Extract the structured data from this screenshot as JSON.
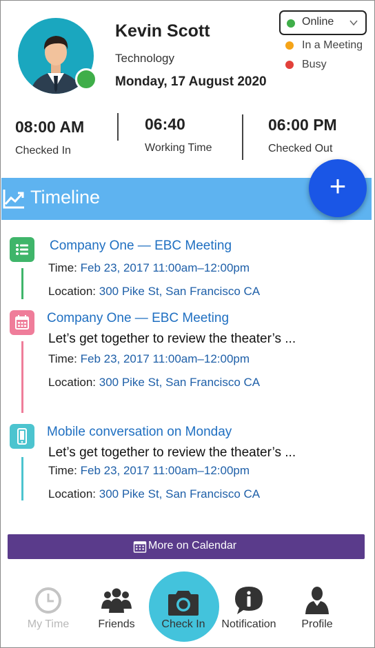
{
  "profile": {
    "name": "Kevin Scott",
    "department": "Technology",
    "date": "Monday, 17 August 2020"
  },
  "status": {
    "selected": {
      "label": "Online",
      "color": "#3fae49"
    },
    "options": [
      {
        "label": "In a Meeting",
        "color": "#f5a418"
      },
      {
        "label": "Busy",
        "color": "#e2403a"
      }
    ]
  },
  "times": {
    "checked_in": {
      "value": "08:00 AM",
      "label": "Checked In"
    },
    "working": {
      "value": "06:40",
      "label": "Working Time"
    },
    "checked_out": {
      "value": "06:00 PM",
      "label": "Checked Out"
    }
  },
  "timeline": {
    "title": "Timeline",
    "add_label": "+",
    "entries": [
      {
        "icon": "list-icon",
        "color": "#3fb56a",
        "title": "Company One — EBC Meeting",
        "description": "",
        "time_label": "Time:",
        "time": "Feb 23, 2017 11:00am–12:00pm",
        "location_label": "Location:",
        "location": "300 Pike St, San Francisco CA"
      },
      {
        "icon": "calendar-icon",
        "color": "#ef7d9a",
        "title": "Company One — EBC Meeting",
        "description": "Let’s get together to review the theater’s ...",
        "time_label": "Time:",
        "time": "Feb 23, 2017 11:00am–12:00pm",
        "location_label": "Location:",
        "location": "300 Pike St, San Francisco CA"
      },
      {
        "icon": "mobile-icon",
        "color": "#4cc4cf",
        "title": "Mobile conversation on Monday",
        "description": "Let’s get together to review the theater’s ...",
        "time_label": "Time:",
        "time": "Feb 23, 2017 11:00am–12:00pm",
        "location_label": "Location:",
        "location": "300 Pike St, San Francisco CA"
      }
    ],
    "more_label": "More on Calendar"
  },
  "nav": {
    "items": [
      {
        "label": "My Time",
        "icon": "clock-icon",
        "disabled": true
      },
      {
        "label": "Friends",
        "icon": "friends-icon"
      },
      {
        "label": "Check In",
        "icon": "camera-icon",
        "active": true
      },
      {
        "label": "Notification",
        "icon": "info-icon"
      },
      {
        "label": "Profile",
        "icon": "profile-icon"
      }
    ]
  },
  "colors": {
    "accent_blue": "#5eb3f0",
    "fab": "#1a56e6",
    "calendar_button": "#5a3b8b",
    "checkin": "#43c3dc"
  }
}
